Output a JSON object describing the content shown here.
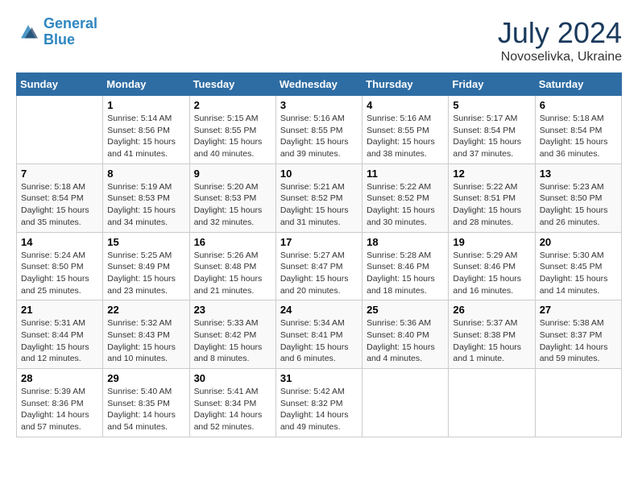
{
  "header": {
    "logo_line1": "General",
    "logo_line2": "Blue",
    "month_year": "July 2024",
    "location": "Novoselivka, Ukraine"
  },
  "columns": [
    "Sunday",
    "Monday",
    "Tuesday",
    "Wednesday",
    "Thursday",
    "Friday",
    "Saturday"
  ],
  "weeks": [
    [
      {
        "day": "",
        "sunrise": "",
        "sunset": "",
        "daylight": ""
      },
      {
        "day": "1",
        "sunrise": "Sunrise: 5:14 AM",
        "sunset": "Sunset: 8:56 PM",
        "daylight": "Daylight: 15 hours and 41 minutes."
      },
      {
        "day": "2",
        "sunrise": "Sunrise: 5:15 AM",
        "sunset": "Sunset: 8:55 PM",
        "daylight": "Daylight: 15 hours and 40 minutes."
      },
      {
        "day": "3",
        "sunrise": "Sunrise: 5:16 AM",
        "sunset": "Sunset: 8:55 PM",
        "daylight": "Daylight: 15 hours and 39 minutes."
      },
      {
        "day": "4",
        "sunrise": "Sunrise: 5:16 AM",
        "sunset": "Sunset: 8:55 PM",
        "daylight": "Daylight: 15 hours and 38 minutes."
      },
      {
        "day": "5",
        "sunrise": "Sunrise: 5:17 AM",
        "sunset": "Sunset: 8:54 PM",
        "daylight": "Daylight: 15 hours and 37 minutes."
      },
      {
        "day": "6",
        "sunrise": "Sunrise: 5:18 AM",
        "sunset": "Sunset: 8:54 PM",
        "daylight": "Daylight: 15 hours and 36 minutes."
      }
    ],
    [
      {
        "day": "7",
        "sunrise": "Sunrise: 5:18 AM",
        "sunset": "Sunset: 8:54 PM",
        "daylight": "Daylight: 15 hours and 35 minutes."
      },
      {
        "day": "8",
        "sunrise": "Sunrise: 5:19 AM",
        "sunset": "Sunset: 8:53 PM",
        "daylight": "Daylight: 15 hours and 34 minutes."
      },
      {
        "day": "9",
        "sunrise": "Sunrise: 5:20 AM",
        "sunset": "Sunset: 8:53 PM",
        "daylight": "Daylight: 15 hours and 32 minutes."
      },
      {
        "day": "10",
        "sunrise": "Sunrise: 5:21 AM",
        "sunset": "Sunset: 8:52 PM",
        "daylight": "Daylight: 15 hours and 31 minutes."
      },
      {
        "day": "11",
        "sunrise": "Sunrise: 5:22 AM",
        "sunset": "Sunset: 8:52 PM",
        "daylight": "Daylight: 15 hours and 30 minutes."
      },
      {
        "day": "12",
        "sunrise": "Sunrise: 5:22 AM",
        "sunset": "Sunset: 8:51 PM",
        "daylight": "Daylight: 15 hours and 28 minutes."
      },
      {
        "day": "13",
        "sunrise": "Sunrise: 5:23 AM",
        "sunset": "Sunset: 8:50 PM",
        "daylight": "Daylight: 15 hours and 26 minutes."
      }
    ],
    [
      {
        "day": "14",
        "sunrise": "Sunrise: 5:24 AM",
        "sunset": "Sunset: 8:50 PM",
        "daylight": "Daylight: 15 hours and 25 minutes."
      },
      {
        "day": "15",
        "sunrise": "Sunrise: 5:25 AM",
        "sunset": "Sunset: 8:49 PM",
        "daylight": "Daylight: 15 hours and 23 minutes."
      },
      {
        "day": "16",
        "sunrise": "Sunrise: 5:26 AM",
        "sunset": "Sunset: 8:48 PM",
        "daylight": "Daylight: 15 hours and 21 minutes."
      },
      {
        "day": "17",
        "sunrise": "Sunrise: 5:27 AM",
        "sunset": "Sunset: 8:47 PM",
        "daylight": "Daylight: 15 hours and 20 minutes."
      },
      {
        "day": "18",
        "sunrise": "Sunrise: 5:28 AM",
        "sunset": "Sunset: 8:46 PM",
        "daylight": "Daylight: 15 hours and 18 minutes."
      },
      {
        "day": "19",
        "sunrise": "Sunrise: 5:29 AM",
        "sunset": "Sunset: 8:46 PM",
        "daylight": "Daylight: 15 hours and 16 minutes."
      },
      {
        "day": "20",
        "sunrise": "Sunrise: 5:30 AM",
        "sunset": "Sunset: 8:45 PM",
        "daylight": "Daylight: 15 hours and 14 minutes."
      }
    ],
    [
      {
        "day": "21",
        "sunrise": "Sunrise: 5:31 AM",
        "sunset": "Sunset: 8:44 PM",
        "daylight": "Daylight: 15 hours and 12 minutes."
      },
      {
        "day": "22",
        "sunrise": "Sunrise: 5:32 AM",
        "sunset": "Sunset: 8:43 PM",
        "daylight": "Daylight: 15 hours and 10 minutes."
      },
      {
        "day": "23",
        "sunrise": "Sunrise: 5:33 AM",
        "sunset": "Sunset: 8:42 PM",
        "daylight": "Daylight: 15 hours and 8 minutes."
      },
      {
        "day": "24",
        "sunrise": "Sunrise: 5:34 AM",
        "sunset": "Sunset: 8:41 PM",
        "daylight": "Daylight: 15 hours and 6 minutes."
      },
      {
        "day": "25",
        "sunrise": "Sunrise: 5:36 AM",
        "sunset": "Sunset: 8:40 PM",
        "daylight": "Daylight: 15 hours and 4 minutes."
      },
      {
        "day": "26",
        "sunrise": "Sunrise: 5:37 AM",
        "sunset": "Sunset: 8:38 PM",
        "daylight": "Daylight: 15 hours and 1 minute."
      },
      {
        "day": "27",
        "sunrise": "Sunrise: 5:38 AM",
        "sunset": "Sunset: 8:37 PM",
        "daylight": "Daylight: 14 hours and 59 minutes."
      }
    ],
    [
      {
        "day": "28",
        "sunrise": "Sunrise: 5:39 AM",
        "sunset": "Sunset: 8:36 PM",
        "daylight": "Daylight: 14 hours and 57 minutes."
      },
      {
        "day": "29",
        "sunrise": "Sunrise: 5:40 AM",
        "sunset": "Sunset: 8:35 PM",
        "daylight": "Daylight: 14 hours and 54 minutes."
      },
      {
        "day": "30",
        "sunrise": "Sunrise: 5:41 AM",
        "sunset": "Sunset: 8:34 PM",
        "daylight": "Daylight: 14 hours and 52 minutes."
      },
      {
        "day": "31",
        "sunrise": "Sunrise: 5:42 AM",
        "sunset": "Sunset: 8:32 PM",
        "daylight": "Daylight: 14 hours and 49 minutes."
      },
      {
        "day": "",
        "sunrise": "",
        "sunset": "",
        "daylight": ""
      },
      {
        "day": "",
        "sunrise": "",
        "sunset": "",
        "daylight": ""
      },
      {
        "day": "",
        "sunrise": "",
        "sunset": "",
        "daylight": ""
      }
    ]
  ]
}
